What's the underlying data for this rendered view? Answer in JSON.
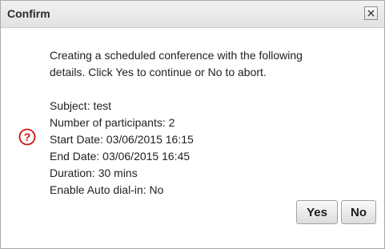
{
  "dialog": {
    "title": "Confirm",
    "intro_line_1": "Creating a scheduled conference with the following",
    "intro_line_2": "details. Click Yes to continue or No to abort.",
    "details": {
      "subject": "Subject: test",
      "participants": "Number of participants: 2",
      "start_date": "Start Date: 03/06/2015 16:15",
      "end_date": "End Date: 03/06/2015 16:45",
      "duration": "Duration: 30 mins",
      "auto_dial_in": "Enable Auto dial-in: No"
    },
    "icon": "question-icon",
    "yes_label": "Yes",
    "no_label": "No",
    "close_icon": "close-icon"
  },
  "colors": {
    "question_accent": "#cc1111",
    "title_bar": "#e8e8e8"
  }
}
